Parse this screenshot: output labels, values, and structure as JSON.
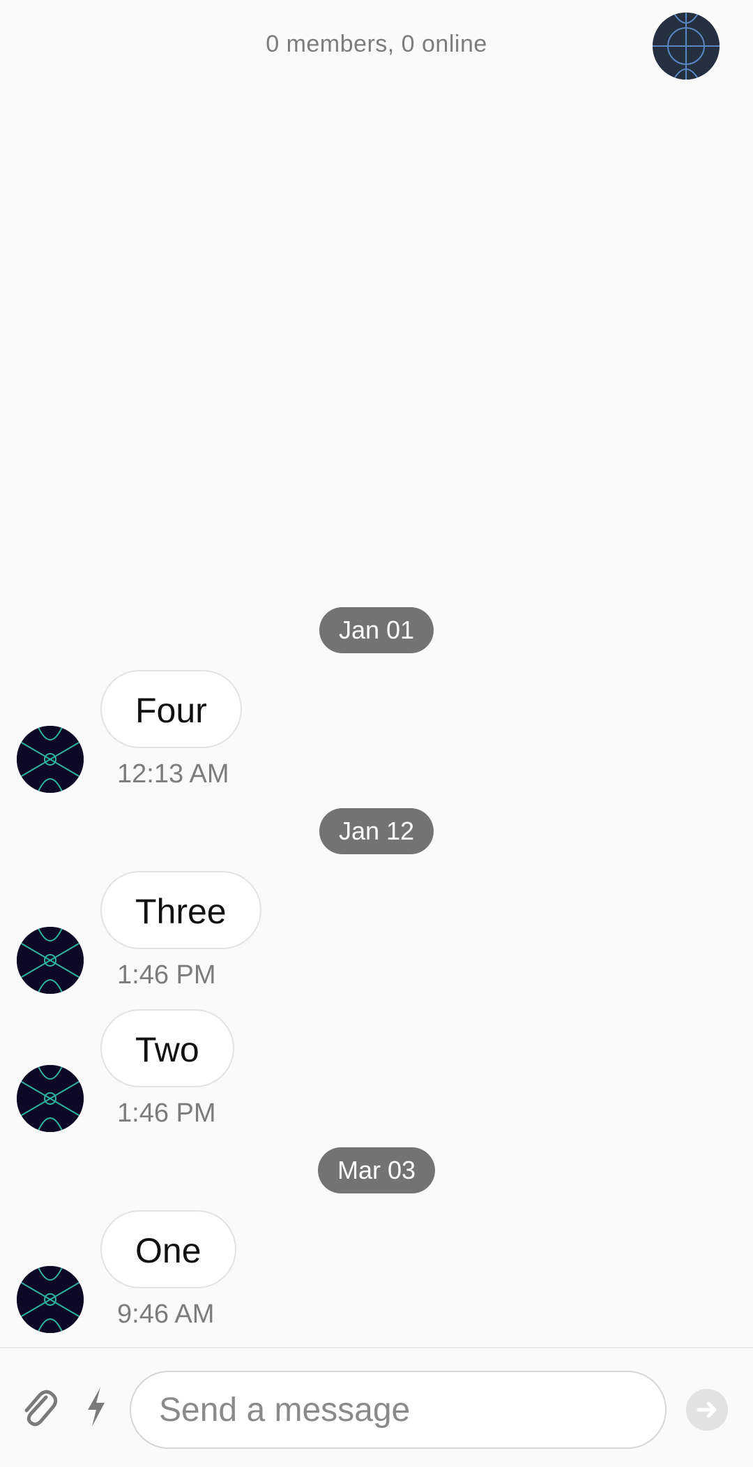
{
  "header": {
    "status": "0 members, 0 online",
    "avatar_icon": "channel-avatar"
  },
  "messages": [
    {
      "date": "Jan 01",
      "items": [
        {
          "text": "Four",
          "time": "12:13 AM",
          "avatar_icon": "user-avatar"
        }
      ]
    },
    {
      "date": "Jan 12",
      "items": [
        {
          "text": "Three",
          "time": "1:46 PM",
          "avatar_icon": "user-avatar"
        },
        {
          "text": "Two",
          "time": "1:46 PM",
          "avatar_icon": "user-avatar"
        }
      ]
    },
    {
      "date": "Mar 03",
      "items": [
        {
          "text": "One",
          "time": "9:46 AM",
          "avatar_icon": "user-avatar"
        }
      ]
    }
  ],
  "composer": {
    "placeholder": "Send a message",
    "value": "",
    "attach_icon": "paperclip-icon",
    "commands_icon": "lightning-icon",
    "send_icon": "arrow-right-icon"
  },
  "colors": {
    "background": "#fafafa",
    "date_pill": "#737373",
    "muted_text": "#7c7c7c",
    "avatar_bg": "#0c0826",
    "avatar_lines": "#2fb6a0"
  }
}
